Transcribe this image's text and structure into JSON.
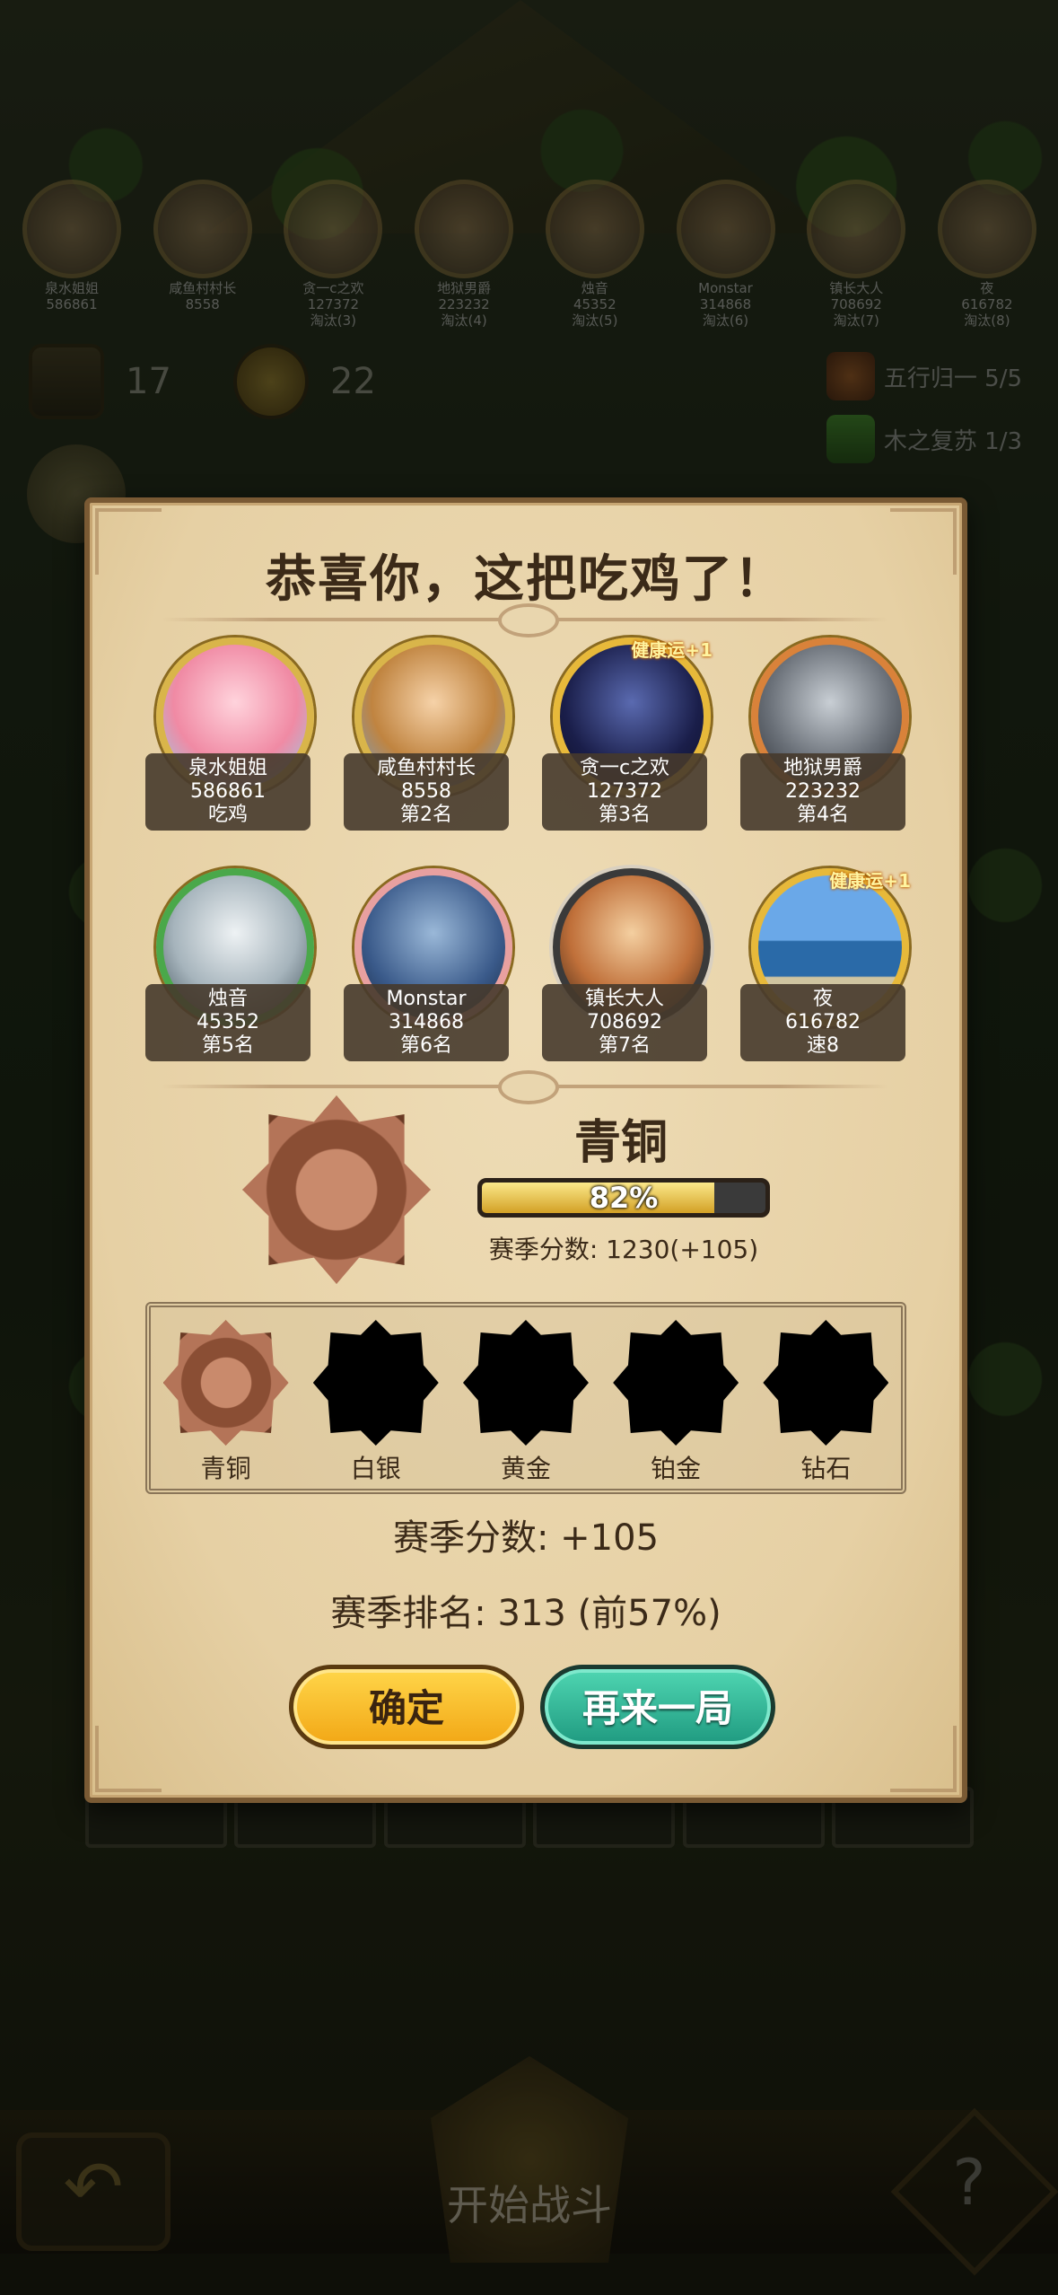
{
  "top_players": [
    {
      "name": "泉水姐姐",
      "score": "586861",
      "status": ""
    },
    {
      "name": "咸鱼村村长",
      "score": "8558",
      "status": ""
    },
    {
      "name": "贪一c之欢",
      "score": "127372",
      "status": "淘汰(3)"
    },
    {
      "name": "地狱男爵",
      "score": "223232",
      "status": "淘汰(4)"
    },
    {
      "name": "烛音",
      "score": "45352",
      "status": "淘汰(5)"
    },
    {
      "name": "Monstar",
      "score": "314868",
      "status": "淘汰(6)"
    },
    {
      "name": "镇长大人",
      "score": "708692",
      "status": "淘汰(7)"
    },
    {
      "name": "夜",
      "score": "616782",
      "status": "淘汰(8)"
    }
  ],
  "hud": {
    "turns": "17",
    "coins": "22"
  },
  "quests": [
    {
      "label": "五行归一 5/5",
      "icon": "five-elements-icon"
    },
    {
      "label": "木之复苏 1/3",
      "icon": "wood-cube-icon"
    }
  ],
  "dialog": {
    "title": "恭喜你，这把吃鸡了！",
    "players": [
      {
        "name": "泉水姐姐",
        "score": "586861",
        "place": "吃鸡",
        "luck": ""
      },
      {
        "name": "咸鱼村村长",
        "score": "8558",
        "place": "第2名",
        "luck": ""
      },
      {
        "name": "贪一c之欢",
        "score": "127372",
        "place": "第3名",
        "luck": "健康运+1"
      },
      {
        "name": "地狱男爵",
        "score": "223232",
        "place": "第4名",
        "luck": ""
      },
      {
        "name": "烛音",
        "score": "45352",
        "place": "第5名",
        "luck": ""
      },
      {
        "name": "Monstar",
        "score": "314868",
        "place": "第6名",
        "luck": ""
      },
      {
        "name": "镇长大人",
        "score": "708692",
        "place": "第7名",
        "luck": ""
      },
      {
        "name": "夜",
        "score": "616782",
        "place": "速8",
        "luck": "健康运+1"
      }
    ],
    "rank": {
      "name": "青铜",
      "progress_pct": 82,
      "progress_label": "82%",
      "season_score": "赛季分数: 1230(+105)"
    },
    "tiers": [
      "青铜",
      "白银",
      "黄金",
      "铂金",
      "钻石"
    ],
    "season_score_delta": "赛季分数: +105",
    "season_rank": "赛季排名: 313 (前57%)",
    "ok_label": "确定",
    "again_label": "再来一局"
  },
  "bottom": {
    "start_label": "开始战斗",
    "back_icon": "back-arrow-icon",
    "help_label": "?"
  }
}
